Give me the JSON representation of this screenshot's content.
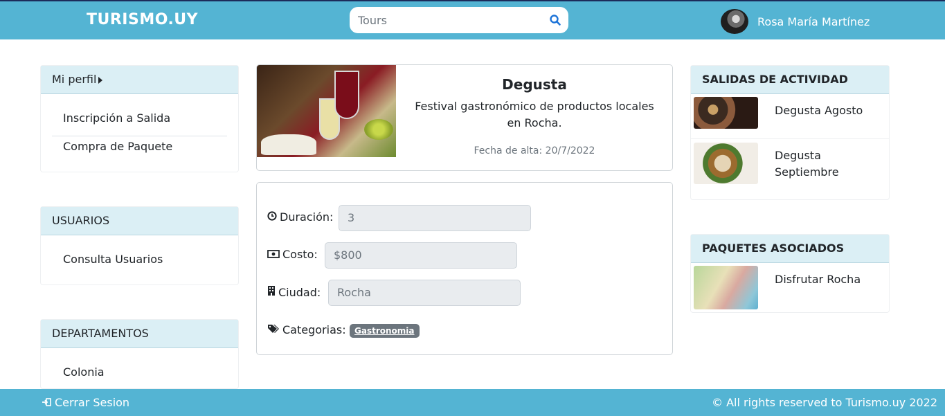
{
  "header": {
    "brand": "TURISMO.UY",
    "search_value": "Tours",
    "user_name": "Rosa María Martínez"
  },
  "sidebar": {
    "profile": {
      "title": "Mi perfil",
      "items": [
        "Inscripción a Salida",
        "Compra de Paquete"
      ]
    },
    "users": {
      "title": "USUARIOS",
      "items": [
        "Consulta Usuarios"
      ]
    },
    "departments": {
      "title": "DEPARTAMENTOS",
      "items": [
        "Colonia"
      ]
    }
  },
  "activity": {
    "title": "Degusta",
    "description": "Festival gastronómico de productos locales en Rocha.",
    "date": "Fecha de alta: 20/7/2022",
    "fields": {
      "duration_label": "Duración:",
      "duration_value": "3",
      "cost_label": "Costo:",
      "cost_value": "$800",
      "city_label": "Ciudad:",
      "city_value": "Rocha",
      "categories_label": "Categorias:",
      "category": "Gastronomia"
    }
  },
  "outings": {
    "title": "SALIDAS DE ACTIVIDAD",
    "items": [
      "Degusta Agosto",
      "Degusta Septiembre"
    ]
  },
  "packages": {
    "title": "PAQUETES ASOCIADOS",
    "items": [
      "Disfrutar Rocha"
    ]
  },
  "footer": {
    "logout": "Cerrar Sesion",
    "copyright": "© All rights reserved to Turismo.uy 2022"
  }
}
